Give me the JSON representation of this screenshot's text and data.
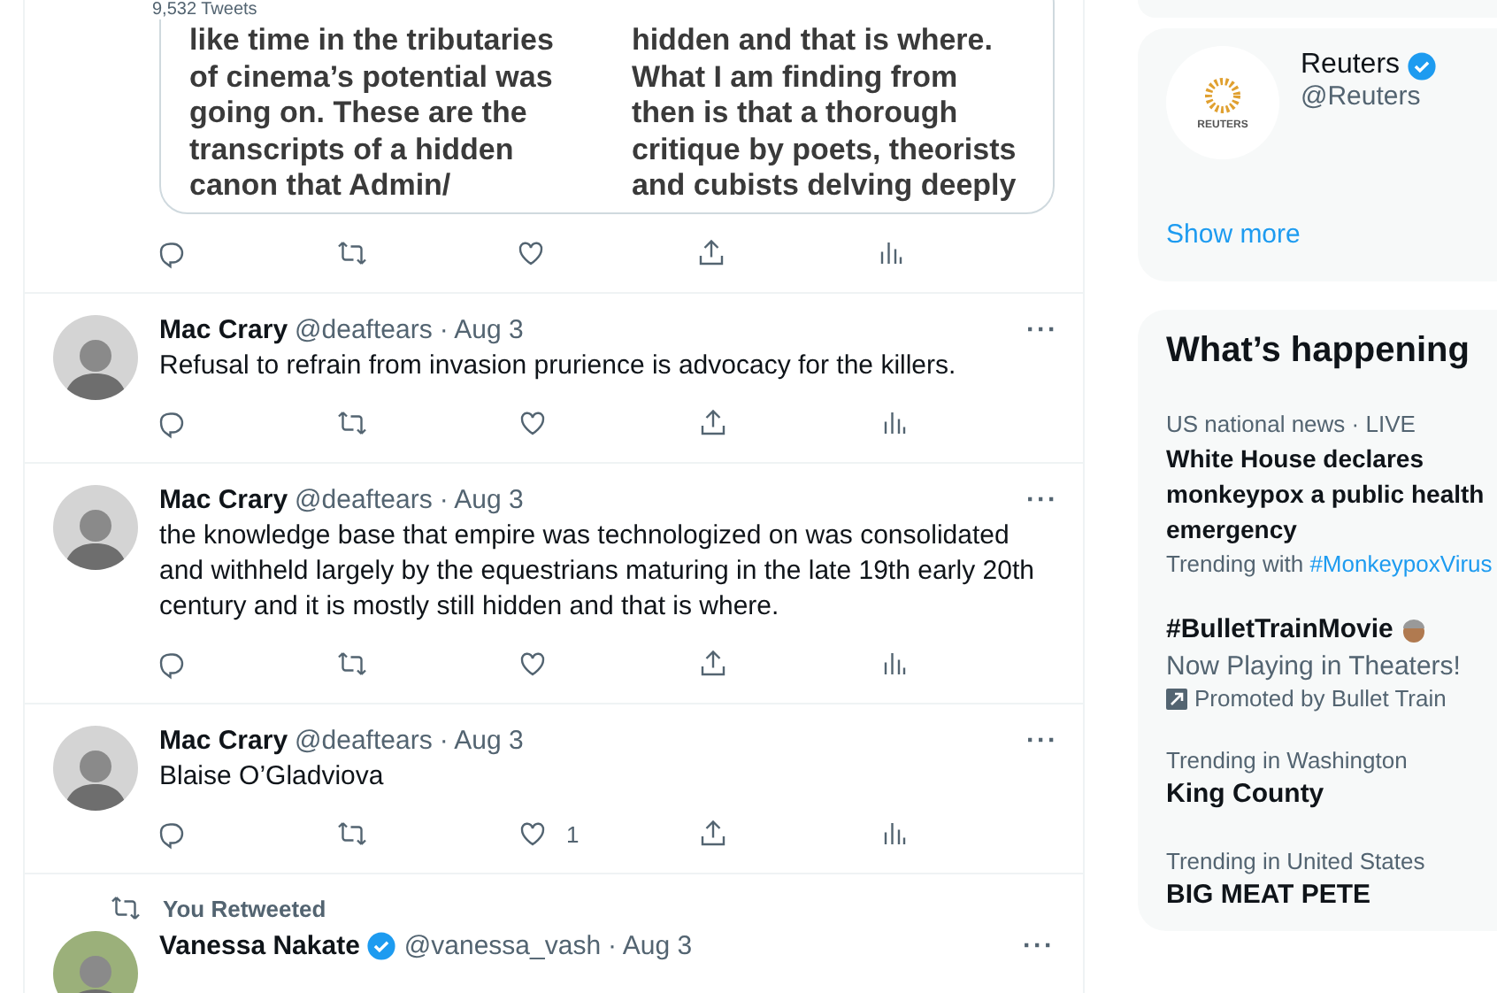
{
  "header": {
    "tweet_count": "9,532 Tweets"
  },
  "image_tweet": {
    "columns": [
      [
        "like time in the tributaries",
        "of cinema’s potential was",
        "going on.  These are the",
        "transcripts of a hidden",
        "canon that Admin/"
      ],
      [
        "hidden and that is where.",
        "What I am finding from",
        "then is that a thorough",
        "critique by poets, theorists",
        "and cubists delving deeply"
      ]
    ],
    "actions": [
      {
        "kind": "reply"
      },
      {
        "kind": "retweet"
      },
      {
        "kind": "like"
      },
      {
        "kind": "share"
      },
      {
        "kind": "analytics"
      }
    ]
  },
  "tweets": [
    {
      "name": "Mac Crary",
      "handle": "@deaftears",
      "date": "· Aug 3",
      "more": "···",
      "text": "Refusal to refrain from invasion prurience is advocacy for the killers.",
      "actions": [
        {
          "kind": "reply"
        },
        {
          "kind": "retweet"
        },
        {
          "kind": "like"
        },
        {
          "kind": "share"
        },
        {
          "kind": "analytics"
        }
      ]
    },
    {
      "name": "Mac Crary",
      "handle": "@deaftears",
      "date": "· Aug 3",
      "more": "···",
      "text": "the knowledge base that empire was technologized on was consolidated and withheld largely by the equestrians maturing in the late 19th early 20th century and it is mostly still hidden and that is where.",
      "actions": [
        {
          "kind": "reply"
        },
        {
          "kind": "retweet"
        },
        {
          "kind": "like"
        },
        {
          "kind": "share"
        },
        {
          "kind": "analytics"
        }
      ]
    },
    {
      "name": "Mac Crary",
      "handle": "@deaftears",
      "date": "· Aug 3",
      "more": "···",
      "text": "Blaise O’Gladviova",
      "actions": [
        {
          "kind": "reply"
        },
        {
          "kind": "retweet"
        },
        {
          "kind": "like",
          "count": "1"
        },
        {
          "kind": "share"
        },
        {
          "kind": "analytics"
        }
      ]
    }
  ],
  "retweet": {
    "context": "You Retweeted",
    "name": "Vanessa Nakate",
    "verified": true,
    "handle": "@vanessa_vash",
    "date": "· Aug 3",
    "more": "···"
  },
  "sidebar": {
    "follow": {
      "name": "Reuters",
      "verified": true,
      "handle": "@Reuters",
      "logo_text": "REUTERS",
      "show_more": "Show more"
    },
    "trends_title": "What’s happening",
    "trends": [
      {
        "kind": "news",
        "context": "US national news · LIVE",
        "title": "White House declares monkeypox a public health emergency",
        "trending_with": "Trending with",
        "hashtag": "#MonkeypoxVirus"
      },
      {
        "kind": "promoted",
        "title": "#BulletTrainMovie",
        "subtitle": "Now Playing in Theaters!",
        "promoted": "Promoted by Bullet Train"
      },
      {
        "kind": "trend",
        "context": "Trending in Washington",
        "title": "King County"
      },
      {
        "kind": "trend",
        "context": "Trending in United States",
        "title": "BIG MEAT PETE"
      }
    ]
  }
}
